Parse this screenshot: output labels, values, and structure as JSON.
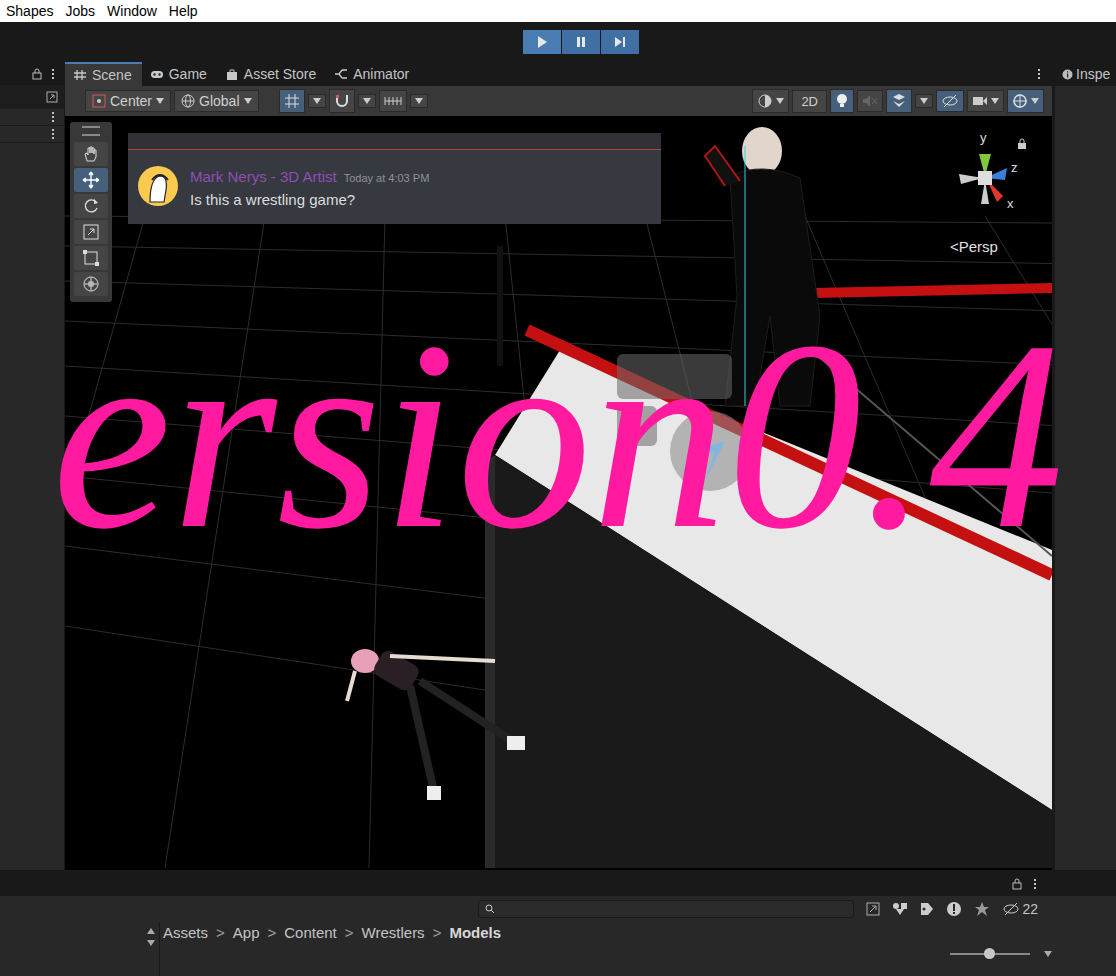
{
  "menu": [
    "Shapes",
    "Jobs",
    "Window",
    "Help"
  ],
  "playback": [
    {
      "kind": "play"
    },
    {
      "kind": "pause"
    },
    {
      "kind": "step"
    }
  ],
  "scene_tabs": [
    {
      "label": "Scene",
      "kind": "scene",
      "selected": true
    },
    {
      "label": "Game",
      "kind": "game",
      "selected": false
    },
    {
      "label": "Asset Store",
      "kind": "store",
      "selected": false
    },
    {
      "label": "Animator",
      "kind": "animator",
      "selected": false
    }
  ],
  "scene_toolbar": {
    "pivot": "Center",
    "space": "Global",
    "view_2d": "2D"
  },
  "tools": [
    {
      "kind": "hand",
      "selected": false
    },
    {
      "kind": "move",
      "selected": true
    },
    {
      "kind": "rotate",
      "selected": false
    },
    {
      "kind": "scale",
      "selected": false
    },
    {
      "kind": "rect",
      "selected": false
    },
    {
      "kind": "transform",
      "selected": false
    }
  ],
  "discord_message": {
    "author": "Mark Nerys - 3D Artist",
    "time": "Today at 4:03 PM",
    "text": "Is this a wrestling game?"
  },
  "gizmo": {
    "axes": [
      "y",
      "z",
      "x"
    ],
    "projection": "<Persp"
  },
  "watermark": "ersion0.4",
  "inspector": {
    "tab": "Inspe"
  },
  "project": {
    "breadcrumbs": [
      {
        "label": "Assets",
        "selected": false
      },
      {
        "label": "App",
        "selected": false
      },
      {
        "label": "Content",
        "selected": false
      },
      {
        "label": "Wrestlers",
        "selected": false
      },
      {
        "label": "Models",
        "selected": true
      }
    ],
    "separator": ">",
    "hidden_count": "22"
  }
}
